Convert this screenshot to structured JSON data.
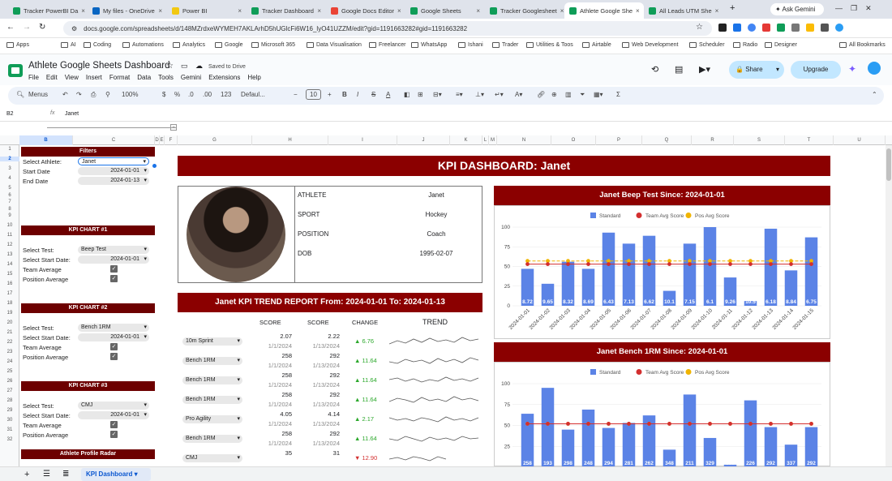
{
  "browser": {
    "tabs": [
      {
        "label": "Tracker PowerBI Da",
        "color": "#0f9d58"
      },
      {
        "label": "My files - OneDrive",
        "color": "#0a66c2"
      },
      {
        "label": "Power BI",
        "color": "#f2c811"
      },
      {
        "label": "Tracker Dashboard",
        "color": "#0f9d58"
      },
      {
        "label": "Google Docs Editor",
        "color": "#ea4335"
      },
      {
        "label": "Google Sheets",
        "color": "#0f9d58"
      },
      {
        "label": "Tracker Googlesheet",
        "color": "#0f9d58"
      },
      {
        "label": "Athlete Google She",
        "color": "#0f9d58",
        "active": true
      },
      {
        "label": "All Leads UTM She",
        "color": "#0f9d58"
      }
    ],
    "ask_gemini": "Ask Gemini",
    "url": "docs.google.com/spreadsheets/d/148MZrdxeWYMEH7AKLArhD5hUGlcFi6W16_lyO41UZZM/edit?gid=1191663282#gid=1191663282",
    "bookmarks": [
      "Apps",
      "AI",
      "Coding",
      "Automations",
      "Analytics",
      "Google",
      "Microsoft 365",
      "Data Visualisation",
      "Freelancer",
      "WhatsApp",
      "Ishani",
      "Trader",
      "Utilities & Toos",
      "Airtable",
      "Web Development",
      "Scheduler",
      "Radio",
      "Designer"
    ],
    "all_bookmarks": "All Bookmarks"
  },
  "doc": {
    "title": "Athlete Google Sheets Dashboard",
    "saved": "Saved to Drive",
    "menus": [
      "File",
      "Edit",
      "View",
      "Insert",
      "Format",
      "Data",
      "Tools",
      "Gemini",
      "Extensions",
      "Help"
    ],
    "share": "Share",
    "upgrade": "Upgrade"
  },
  "toolbar": {
    "menus": "Menus",
    "zoom": "100%",
    "currency": "$",
    "percent": "%",
    "dec1": ".0",
    "dec2": ".00",
    "fmt": "123",
    "font": "Defaul...",
    "size": "10",
    "bold": "B",
    "italic": "I",
    "strike": "S",
    "underline": "A"
  },
  "formula": {
    "cell": "B2",
    "fx": "fx",
    "value": "Janet"
  },
  "columns": [
    "A",
    "B",
    "C",
    "D",
    "E",
    "F",
    "G",
    "H",
    "I",
    "J",
    "K",
    "L",
    "M",
    "N",
    "O",
    "P",
    "Q",
    "R",
    "S",
    "T",
    "U"
  ],
  "sidebar": {
    "filters": "Filters",
    "select_athlete_label": "Select Athlete:",
    "athlete": "Janet",
    "start_label": "Start Date",
    "start": "2024-01-01",
    "end_label": "End Date",
    "end": "2024-01-13",
    "chart1": "KPI CHART #1",
    "chart2": "KPI CHART #2",
    "chart3": "KPI CHART #3",
    "radar": "Athlete Profile Radar",
    "select_test": "Select Test:",
    "select_start": "Select Start Date:",
    "team_avg": "Team Average",
    "pos_avg": "Position Average",
    "test1": "Beep Test",
    "test2": "Bench 1RM",
    "test3": "CMJ",
    "date1": "2024-01-01",
    "date2": "2024-01-01",
    "date3": "2024-01-01",
    "check": "✓"
  },
  "dashboard": {
    "title": "KPI DASHBOARD: Janet",
    "profile": [
      {
        "k": "ATHLETE",
        "v": "Janet"
      },
      {
        "k": "SPORT",
        "v": "Hockey"
      },
      {
        "k": "POSITION",
        "v": "Coach"
      },
      {
        "k": "DOB",
        "v": "1995-02-07"
      }
    ],
    "trend_title": "Janet KPI TREND REPORT From: 2024-01-01 To: 2024-01-13",
    "trend_headers": {
      "score1": "SCORE",
      "score2": "SCORE",
      "change": "CHANGE",
      "trend": "TREND"
    },
    "trend_rows": [
      {
        "test": "10m Sprint",
        "s1": "2.07",
        "d1": "1/1/2024",
        "s2": "2.22",
        "d2": "1/13/2024",
        "change": "▲ 6.76",
        "up": true
      },
      {
        "test": "Bench 1RM",
        "s1": "258",
        "d1": "1/1/2024",
        "s2": "292",
        "d2": "1/13/2024",
        "change": "▲ 11.64",
        "up": true
      },
      {
        "test": "Bench 1RM",
        "s1": "258",
        "d1": "1/1/2024",
        "s2": "292",
        "d2": "1/13/2024",
        "change": "▲ 11.64",
        "up": true
      },
      {
        "test": "Bench 1RM",
        "s1": "258",
        "d1": "1/1/2024",
        "s2": "292",
        "d2": "1/13/2024",
        "change": "▲ 11.64",
        "up": true
      },
      {
        "test": "Pro Agility",
        "s1": "4.05",
        "d1": "1/1/2024",
        "s2": "4.14",
        "d2": "1/13/2024",
        "change": "▲ 2.17",
        "up": true
      },
      {
        "test": "Bench 1RM",
        "s1": "258",
        "d1": "1/1/2024",
        "s2": "292",
        "d2": "1/13/2024",
        "change": "▲ 11.64",
        "up": true
      },
      {
        "test": "CMJ",
        "s1": "35",
        "d1": "",
        "s2": "31",
        "d2": "",
        "change": "▼ 12.90",
        "up": false
      }
    ]
  },
  "chart_data": [
    {
      "type": "bar",
      "title": "Janet Beep Test Since: 2024-01-01",
      "legend": [
        "Standard",
        "Team Avg Score",
        "Pos Avg Score"
      ],
      "categories": [
        "2024-01-01",
        "2024-01-02",
        "2024-01-03",
        "2024-01-04",
        "2024-01-05",
        "2024-01-06",
        "2024-01-07",
        "2024-01-08",
        "2024-01-09",
        "2024-01-10",
        "2024-01-11",
        "2024-01-12",
        "2024-01-13",
        "2024-01-14",
        "2024-01-15"
      ],
      "values": [
        47,
        28,
        56,
        47,
        93,
        79,
        89,
        19,
        79,
        100,
        36,
        6,
        98,
        45,
        87
      ],
      "labels": [
        "8.72",
        "9.65",
        "8.32",
        "8.69",
        "6.43",
        "7.13",
        "6.62",
        "10.1",
        "7.15",
        "6.1",
        "9.26",
        "10.5",
        "6.18",
        "8.84",
        "6.75"
      ],
      "team_avg": 53,
      "pos_avg": 57,
      "ylim": [
        0,
        100
      ],
      "yticks": [
        0,
        25,
        50,
        75,
        100
      ],
      "colors": {
        "bar": "#5b83e6",
        "team": "#d32f2f",
        "pos": "#f0b400"
      }
    },
    {
      "type": "bar",
      "title": "Janet Bench 1RM Since: 2024-01-01",
      "legend": [
        "Standard",
        "Team Avg Score",
        "Pos Avg Score"
      ],
      "values": [
        64,
        95,
        45,
        69,
        47,
        53,
        62,
        21,
        87,
        35,
        3,
        80,
        48,
        27,
        48
      ],
      "labels": [
        "258",
        "193",
        "298",
        "248",
        "294",
        "281",
        "262",
        "348",
        "211",
        "329",
        "390",
        "226",
        "292",
        "337",
        "292"
      ],
      "team_avg": 52,
      "pos_avg": 52,
      "ylim": [
        0,
        100
      ],
      "yticks": [
        25,
        50,
        75,
        100
      ],
      "colors": {
        "bar": "#5b83e6",
        "team": "#d32f2f",
        "pos": "#f0b400"
      }
    }
  ],
  "bottom": {
    "sheet": "KPI Dashboard",
    "add": "+"
  }
}
